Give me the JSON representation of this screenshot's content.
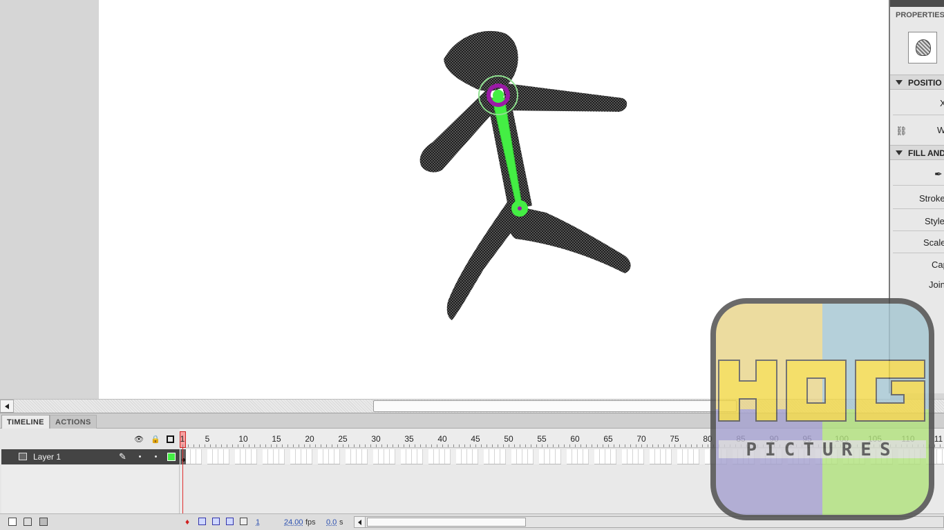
{
  "timeline": {
    "tabs": [
      {
        "label": "TIMELINE"
      },
      {
        "label": "ACTIONS"
      }
    ],
    "ruler_labels": [
      "1",
      "5",
      "10",
      "15",
      "20",
      "25",
      "30",
      "35",
      "40",
      "45",
      "50",
      "55",
      "60",
      "65",
      "70",
      "75",
      "80",
      "85",
      "90",
      "95",
      "100",
      "105",
      "110",
      "11"
    ],
    "layer": {
      "name": "Layer 1",
      "color": "#44ee44"
    },
    "footer": {
      "current_frame": "1",
      "fps_value": "24.00",
      "fps_unit": "fps",
      "time_value": "0.0",
      "time_unit": "s"
    }
  },
  "properties": {
    "title": "PROPERTIES",
    "sections": [
      {
        "label": "POSITIO"
      },
      {
        "label": "FILL AND"
      }
    ],
    "labels": {
      "x": "X",
      "w": "W",
      "stroke": "Stroke",
      "style": "Style",
      "scale": "Scale",
      "cap": "Cap",
      "join": "Join"
    }
  },
  "stage": {
    "background": "#ffffff",
    "figure_color": "#222222",
    "bone_color": "#44ee44",
    "joint_color": "#9b19a6"
  },
  "icons": [
    "eye-icon",
    "lock-icon",
    "outline-icon",
    "layer-icon",
    "pencil-icon",
    "new-layer-icon",
    "new-folder-icon",
    "trash-icon",
    "onion-skin-icon",
    "link-icon",
    "pen-icon"
  ],
  "watermark": {
    "text": "HOG",
    "subtext": "PICTURES",
    "colors": [
      "#e9d58a",
      "#a6c6d2",
      "#a6a2d0",
      "#b2e27e"
    ]
  }
}
